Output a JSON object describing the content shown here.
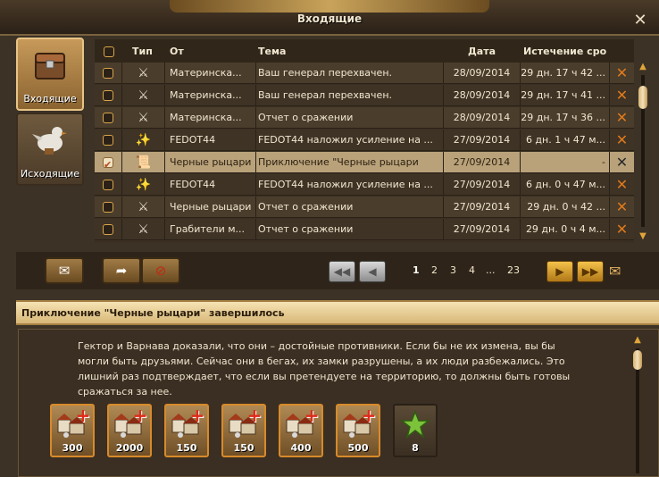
{
  "window": {
    "title": "Входящие"
  },
  "tabs": {
    "inbox": "Входящие",
    "outbox": "Исходящие"
  },
  "columns": {
    "type": "Тип",
    "from": "От",
    "subject": "Тема",
    "date": "Дата",
    "expires": "Истечение сро"
  },
  "messages": [
    {
      "type_icon": "crossed-swords-icon",
      "from": "Материнска...",
      "subject": "Ваш генерал перехвачен.",
      "date": "28/09/2014",
      "expires": "29 дн. 17 ч 42 ...",
      "selected": false
    },
    {
      "type_icon": "crossed-swords-icon",
      "from": "Материнска...",
      "subject": "Ваш генерал перехвачен.",
      "date": "28/09/2014",
      "expires": "29 дн. 17 ч 41 ...",
      "selected": false
    },
    {
      "type_icon": "crossed-swords-icon",
      "from": "Материнска...",
      "subject": "Отчет о сражении",
      "date": "28/09/2014",
      "expires": "29 дн. 17 ч 36 ...",
      "selected": false
    },
    {
      "type_icon": "sparkle-buff-icon",
      "from": "FEDOT44",
      "subject": "FEDOT44 наложил усиление на ...",
      "date": "27/09/2014",
      "expires": "6 дн. 1 ч 47 м...",
      "selected": false
    },
    {
      "type_icon": "scroll-map-icon",
      "from": "Черные рыцари",
      "subject": "Приключение \"Черные рыцари",
      "date": "27/09/2014",
      "expires": "-",
      "selected": true
    },
    {
      "type_icon": "sparkle-buff-icon",
      "from": "FEDOT44",
      "subject": "FEDOT44 наложил усиление на ...",
      "date": "27/09/2014",
      "expires": "6 дн. 0 ч 47 м...",
      "selected": false
    },
    {
      "type_icon": "crossed-swords-icon",
      "from": "Черные рыцари",
      "subject": "Отчет о сражении",
      "date": "27/09/2014",
      "expires": "29 дн. 0 ч 42 ...",
      "selected": false
    },
    {
      "type_icon": "crossed-swords-icon",
      "from": "Грабители м...",
      "subject": "Отчет о сражении",
      "date": "27/09/2014",
      "expires": "29 дн. 0 ч 4 м...",
      "selected": false
    }
  ],
  "pagination": {
    "pages": [
      "1",
      "2",
      "3",
      "4",
      "...",
      "23"
    ],
    "current": "1"
  },
  "message": {
    "subject": "Приключение \"Черные рыцари\" завершилось",
    "body": "Гектор и Варнава доказали, что они – достойные противники. Если бы не их измена, вы бы могли быть друзьями. Сейчас они в бегах, их замки разрушены, а их люди разбежались. Это лишний раз подтверждает, что если вы претендуете на территорию, то должны быть готовы сражаться за нее.",
    "rewards": [
      {
        "icon": "buildings-plus-icon",
        "qty": "300"
      },
      {
        "icon": "buildings-plus-icon",
        "qty": "2000"
      },
      {
        "icon": "buildings-plus-icon",
        "qty": "150"
      },
      {
        "icon": "buildings-plus-icon",
        "qty": "150"
      },
      {
        "icon": "buildings-plus-icon",
        "qty": "400"
      },
      {
        "icon": "buildings-plus-icon",
        "qty": "500"
      },
      {
        "icon": "green-star-icon",
        "qty": "8"
      }
    ]
  },
  "colors": {
    "accent": "#e07a1c",
    "selected_row": "#b9a27a",
    "subject_bar": "#f5e2b3"
  }
}
